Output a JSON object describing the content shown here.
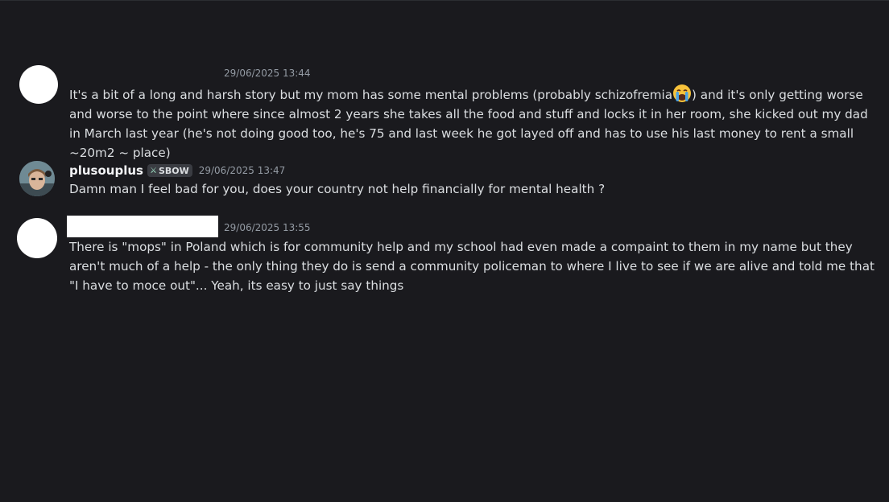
{
  "messages": [
    {
      "username": "",
      "timestamp": "29/06/2025 13:44",
      "text_before_emoji": "It's a bit of a long and harsh story but my mom has some mental problems (probably schizofremia",
      "emoji": "loudly-crying-face",
      "text_after_emoji": ") and it's only getting worse and worse to the point where since almost 2 years she takes all the food and stuff and locks it in her room, she kicked out my dad in March last year (he's not doing good too, he's 75 and last week he got layed off and has to use his last money to rent a small ~20m2 ~ place)"
    },
    {
      "username": "plusouplus",
      "tag": "SBOW",
      "timestamp": "29/06/2025 13:47",
      "text": "Damn man I feel bad for you, does your country not help financially for mental health ?"
    },
    {
      "username": "",
      "timestamp": "29/06/2025 13:55",
      "text": "There is \"mops\" in Poland which is for community help  and my school had even made a compaint to them in my name but they aren't much of a help - the only thing they do is send a community policeman to where I live to see if we are alive and told me that \"I have to moce out\"... Yeah, its easy to just say things"
    }
  ],
  "colors": {
    "background": "#1a1a1e",
    "text": "#dbdee1",
    "timestamp": "#949ba4",
    "username": "#f2f3f5"
  }
}
